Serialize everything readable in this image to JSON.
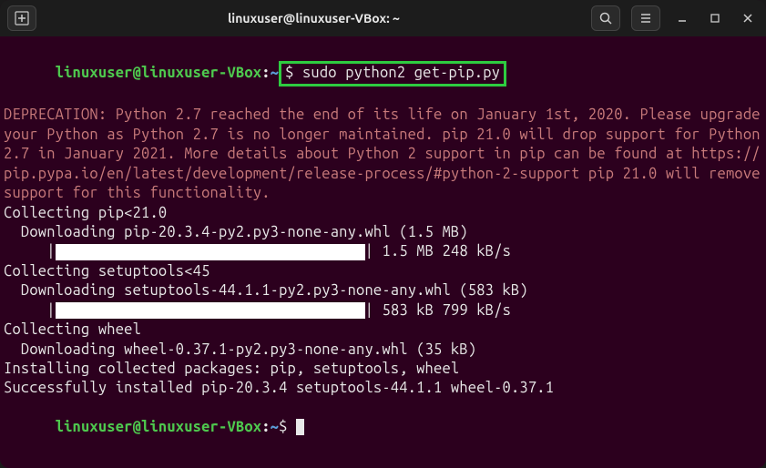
{
  "window": {
    "title": "linuxuser@linuxuser-VBox: ~"
  },
  "prompt": {
    "userhost": "linuxuser@linuxuser-VBox",
    "path": "~",
    "symbol": "$"
  },
  "command": "$ sudo python2 get-pip.py",
  "deprecation": "DEPRECATION: Python 2.7 reached the end of its life on January 1st, 2020. Please upgrade your Python as Python 2.7 is no longer maintained. pip 21.0 will drop support for Python 2.7 in January 2021. More details about Python 2 support in pip can be found at https://pip.pypa.io/en/latest/development/release-process/#python-2-support pip 21.0 will remove support for this functionality.",
  "output": {
    "collecting_pip": "Collecting pip<21.0",
    "downloading_pip": "  Downloading pip-20.3.4-py2.py3-none-any.whl (1.5 MB)",
    "progress_pip": "| 1.5 MB 248 kB/s",
    "collecting_setuptools": "Collecting setuptools<45",
    "downloading_setuptools": "  Downloading setuptools-44.1.1-py2.py3-none-any.whl (583 kB)",
    "progress_setuptools": "| 583 kB 799 kB/s",
    "collecting_wheel": "Collecting wheel",
    "downloading_wheel": "  Downloading wheel-0.37.1-py2.py3-none-any.whl (35 kB)",
    "installing": "Installing collected packages: pip, setuptools, wheel",
    "success": "Successfully installed pip-20.3.4 setuptools-44.1.1 wheel-0.37.1"
  }
}
